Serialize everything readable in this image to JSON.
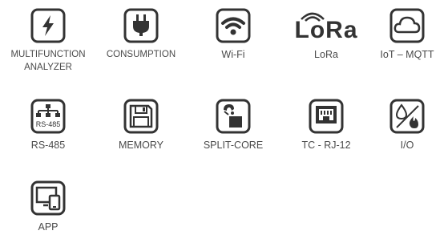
{
  "colors": {
    "icon_stroke": "#333333",
    "label_text": "#4a4a4a"
  },
  "features": [
    {
      "label": "MULTIFUNCTION",
      "label_line2": "ANALYZER",
      "icon": "lightning-bolt-icon"
    },
    {
      "label": "CONSUMPTION",
      "icon": "power-plug-icon"
    },
    {
      "label": "Wi-Fi",
      "icon": "wifi-icon"
    },
    {
      "label": "LoRa",
      "icon": "lora-logo",
      "logo_text": "LoRa"
    },
    {
      "label": "IoT – MQTT",
      "icon": "cloud-icon"
    },
    {
      "label": "RS-485",
      "icon": "network-rs485-icon",
      "icon_text": "RS-485"
    },
    {
      "label": "MEMORY",
      "icon": "floppy-disk-icon"
    },
    {
      "label": "SPLIT-CORE",
      "icon": "split-core-clamp-icon"
    },
    {
      "label": "TC - RJ-12",
      "icon": "rj12-port-icon"
    },
    {
      "label": "I/O",
      "icon": "water-fire-io-icon"
    },
    {
      "label": "APP",
      "icon": "devices-icon"
    }
  ]
}
